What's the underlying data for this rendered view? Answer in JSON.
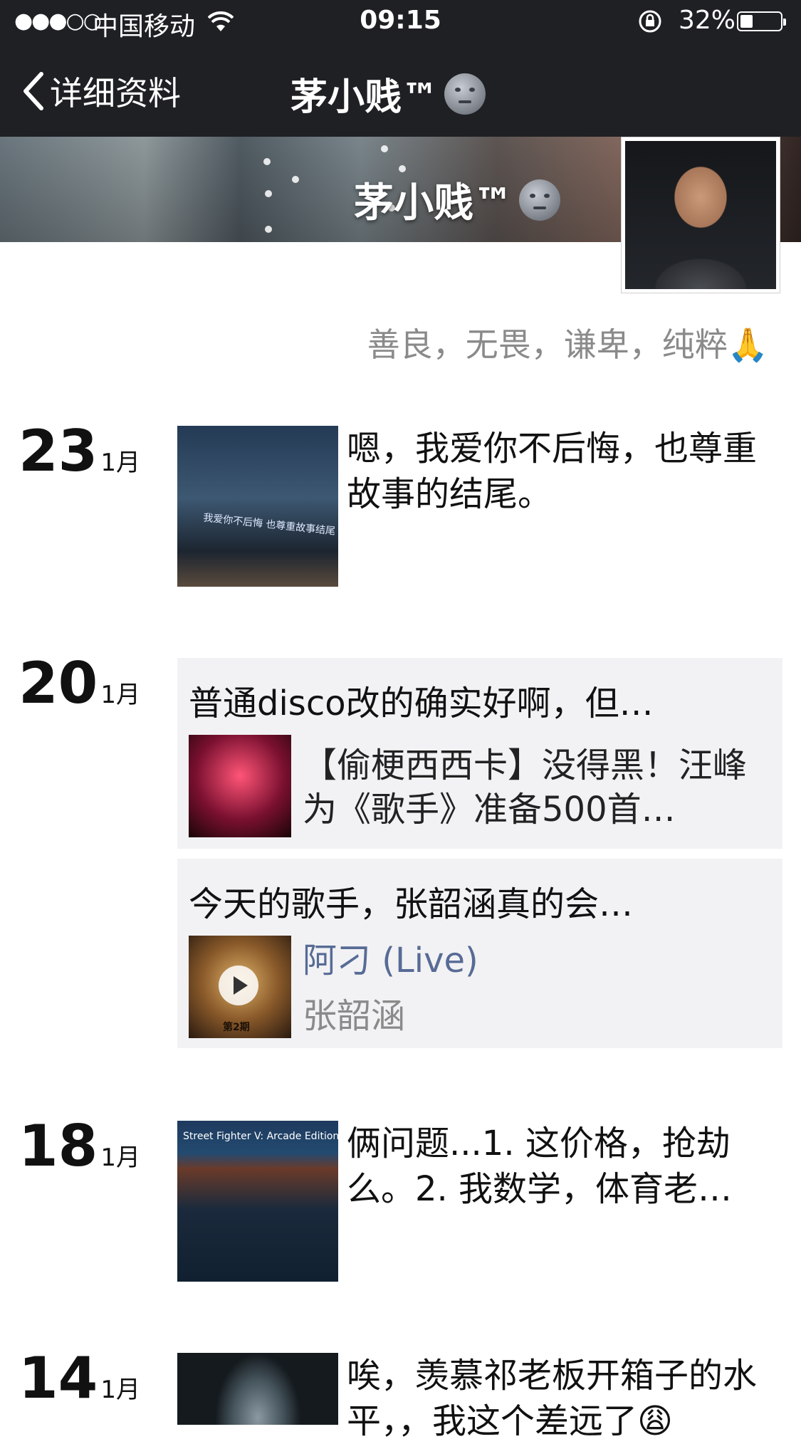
{
  "status_bar": {
    "signal": "●●●○○",
    "carrier": "中国移动",
    "time": "09:15",
    "battery": "32%",
    "battery_level": 0.32
  },
  "nav": {
    "back_label": "详细资料",
    "title": "茅小贱™"
  },
  "profile": {
    "name": "茅小贱™",
    "signature": "善良，无畏，谦卑，纯粹🙏"
  },
  "timeline": [
    {
      "day": "23",
      "month": "1月",
      "text": "嗯，我爱你不后悔，也尊重故事的结尾。",
      "thumb_caption": "我爱你不后悔 也尊重故事结尾"
    },
    {
      "day": "20",
      "month": "1月",
      "shares": [
        {
          "caption": "普通disco改的确实好啊，但…",
          "link_text": "【偷梗西西卡】没得黑！汪峰为《歌手》准备500首…"
        },
        {
          "caption": "今天的歌手，张韶涵真的会…",
          "music_title": "阿刁 (Live)",
          "music_artist": "张韶涵",
          "thumb_caption": "第2期"
        }
      ]
    },
    {
      "day": "18",
      "month": "1月",
      "text": "俩问题...1. 这价格，抢劫么。2. 我数学，体育老…",
      "thumb_caption": "Street Fighter V: Arcade Edition"
    },
    {
      "day": "14",
      "month": "1月",
      "text": "唉，羡慕祁老板开箱子的水平，，我这个差远了😩"
    }
  ]
}
